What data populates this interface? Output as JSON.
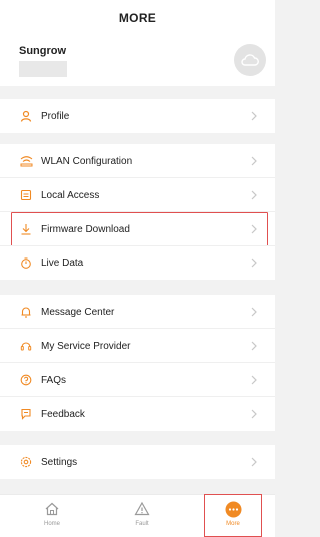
{
  "header": {
    "title": "MORE",
    "username": "Sungrow"
  },
  "menu": {
    "profile": "Profile",
    "wlan": "WLAN Configuration",
    "local_access": "Local Access",
    "firmware": "Firmware Download",
    "live_data": "Live Data",
    "message_center": "Message Center",
    "service_provider": "My Service Provider",
    "faqs": "FAQs",
    "feedback": "Feedback",
    "settings": "Settings"
  },
  "tabs": {
    "home": "Home",
    "fault": "Fault",
    "more": "More"
  },
  "colors": {
    "accent": "#f08a24",
    "highlight": "#e05050"
  }
}
